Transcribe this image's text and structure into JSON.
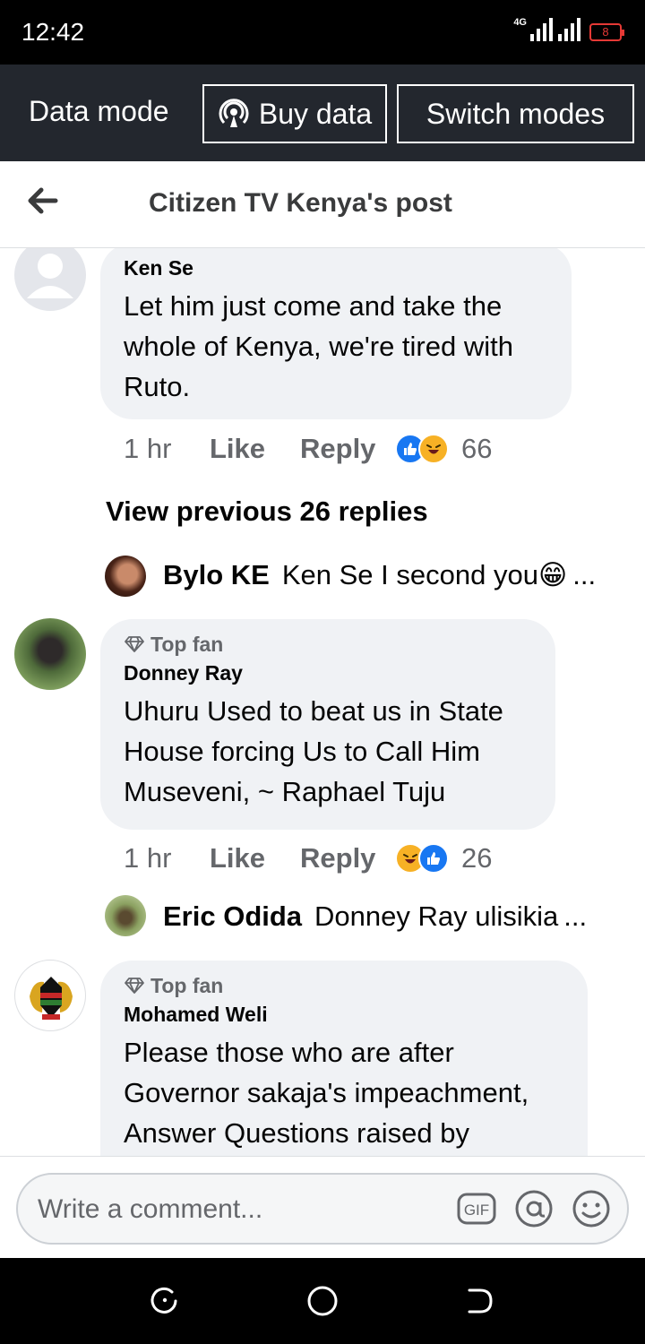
{
  "status_bar": {
    "time": "12:42",
    "network": "4G",
    "battery": "8"
  },
  "data_bar": {
    "label": "Data mode",
    "buy_label": "Buy data",
    "switch_label": "Switch modes"
  },
  "header": {
    "title": "Citizen TV Kenya's post"
  },
  "comments": [
    {
      "name": "Ken Se",
      "badge": "",
      "lines": [
        "Let him just come and take the",
        "whole of Kenya, we're tired with",
        "Ruto."
      ],
      "time": "1 hr",
      "like": "Like",
      "reply": "Reply",
      "reactions": [
        "like",
        "haha"
      ],
      "reaction_count": "66",
      "view_previous": "View previous 26 replies",
      "reply_preview": {
        "name": "Bylo KE",
        "text": "Ken Se I second you😁",
        "more": "..."
      }
    },
    {
      "name": "Donney Ray",
      "badge": "Top fan",
      "lines": [
        "Uhuru Used to beat us in State",
        "House forcing Us to Call Him",
        "Museveni, ~ Raphael Tuju"
      ],
      "time": "1 hr",
      "like": "Like",
      "reply": "Reply",
      "reactions": [
        "haha",
        "like"
      ],
      "reaction_count": "26",
      "reply_preview": {
        "name": "Eric Odida",
        "text": "Donney Ray ulisikia",
        "more": "..."
      }
    },
    {
      "name": "Mohamed Weli",
      "badge": "Top fan",
      "lines": [
        "Please those who are after",
        "Governor sakaja's impeachment,",
        "Answer Questions raised by"
      ]
    }
  ],
  "composer": {
    "placeholder": "Write a comment...",
    "gif_label": "GIF"
  },
  "colors": {
    "accent": "#1877f2",
    "data_bar": "#23272e",
    "bubble": "#f0f2f5",
    "muted": "#65676b"
  }
}
